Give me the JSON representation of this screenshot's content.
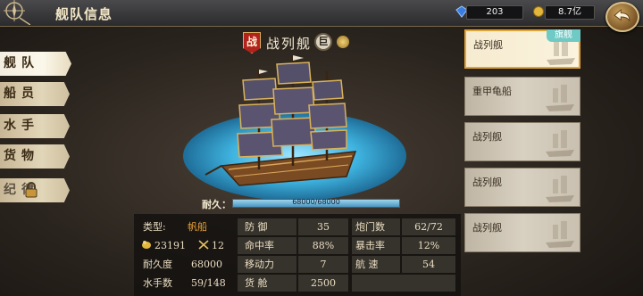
{
  "window": {
    "title": "舰队信息"
  },
  "resources": {
    "gems": "203",
    "gold": "8.7亿"
  },
  "menu": [
    {
      "label": "舰队",
      "active": true
    },
    {
      "label": "船员",
      "active": false
    },
    {
      "label": "水手",
      "active": false
    },
    {
      "label": "货物",
      "active": false
    },
    {
      "label": "纪律",
      "active": false,
      "locked": true
    }
  ],
  "ship": {
    "badge": "战",
    "name": "战列舰",
    "size_badge": "巨",
    "durability_label": "耐久：",
    "durability_text": "68000/68000",
    "durability_fraction": 1.0
  },
  "stats": {
    "rows": [
      [
        {
          "label": "类型:",
          "value": "帆船",
          "value_class": "orange"
        },
        {
          "label": "防 御",
          "value": "35"
        },
        {
          "label": "炮门数",
          "value": "62/72"
        }
      ],
      [
        {
          "icon": "gold-coin-icon",
          "label": "23191",
          "icon2": "crossed-swords-icon",
          "label2": "12"
        },
        {
          "label": "命中率",
          "value": "88%"
        },
        {
          "label": "暴击率",
          "value": "12%"
        }
      ],
      [
        {
          "label": "耐久度",
          "value": "68000"
        },
        {
          "label": "移动力",
          "value": "7"
        },
        {
          "label": "航 速",
          "value": "54"
        }
      ],
      [
        {
          "label": "水手数",
          "value": "59/148"
        },
        {
          "label": "货 舱",
          "value": "2500"
        },
        {
          "label": "",
          "value": ""
        }
      ]
    ]
  },
  "fleet": [
    {
      "name": "战列舰",
      "selected": true,
      "tag": "旗舰"
    },
    {
      "name": "重甲龟船",
      "selected": false
    },
    {
      "name": "战列舰",
      "selected": false
    },
    {
      "name": "战列舰",
      "selected": false
    },
    {
      "name": "战列舰",
      "selected": false
    }
  ],
  "colors": {
    "accent": "#e2a436",
    "highlight_text": "#e8a23a",
    "flag_badge": "#6fc9c4"
  }
}
